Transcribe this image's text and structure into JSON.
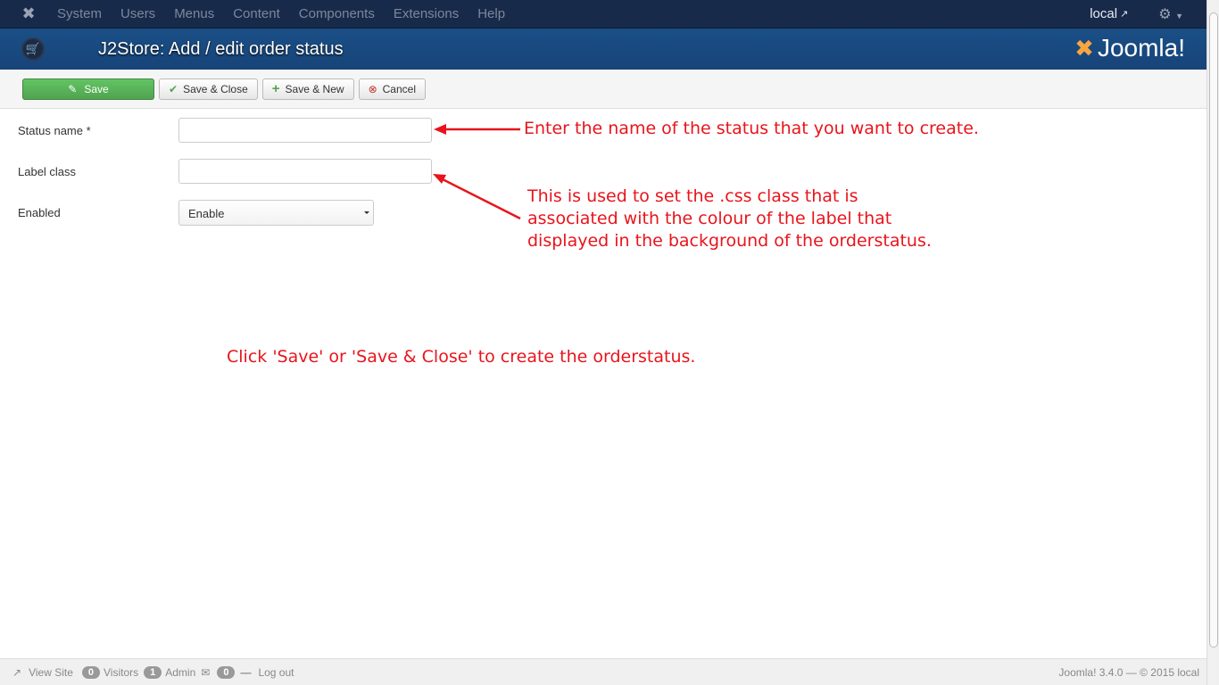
{
  "nav": {
    "menu": [
      "System",
      "Users",
      "Menus",
      "Content",
      "Components",
      "Extensions",
      "Help"
    ],
    "site_link": "local"
  },
  "header": {
    "title": "J2Store: Add / edit order status",
    "brand": "Joomla!"
  },
  "toolbar": {
    "save": "Save",
    "save_close": "Save & Close",
    "save_new": "Save & New",
    "cancel": "Cancel"
  },
  "form": {
    "status_name_label": "Status name *",
    "status_name_value": "",
    "label_class_label": "Label class",
    "label_class_value": "",
    "enabled_label": "Enabled",
    "enabled_value": "Enable"
  },
  "annotations": {
    "a1": "Enter the name of the status that you want to create.",
    "a2_l1": "This is used to set the .css class that is",
    "a2_l2": "associated with the colour of the label that",
    "a2_l3": "displayed in the background of the orderstatus.",
    "a3": "Click 'Save' or 'Save & Close' to create the orderstatus."
  },
  "footer": {
    "view_site": "View Site",
    "visitors_count": "0",
    "visitors": "Visitors",
    "admin_count": "1",
    "admin": "Admin",
    "messages_count": "0",
    "logout": "Log out",
    "copyright": "Joomla! 3.4.0  —  © 2015 local"
  }
}
